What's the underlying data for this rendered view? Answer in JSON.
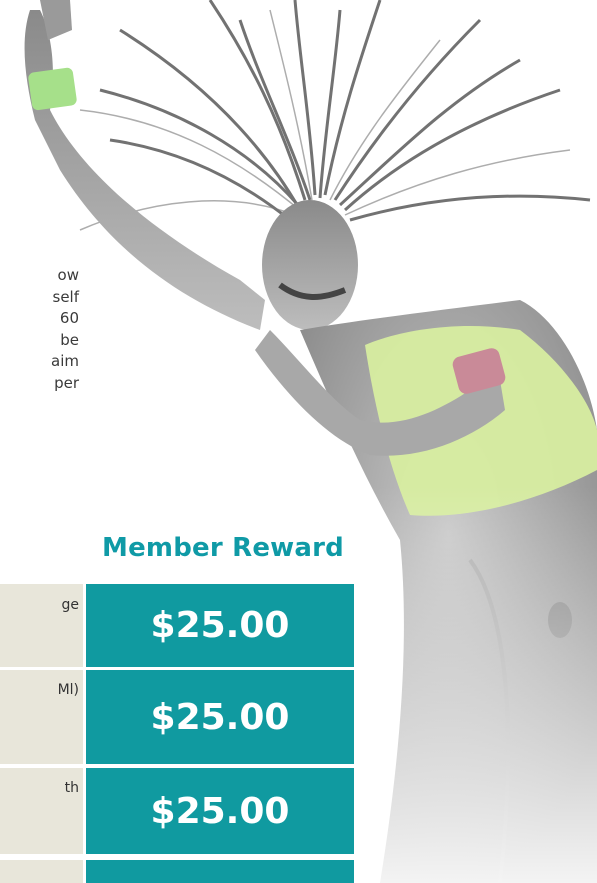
{
  "paragraph_lines": [
    "ow",
    "self",
    "60",
    "be",
    "aim",
    "per"
  ],
  "member_reward": {
    "heading": "Member Reward",
    "rows": [
      {
        "label_fragment": "ge",
        "amount": "$25.00"
      },
      {
        "label_fragment": "Ml)",
        "amount": "$25.00"
      },
      {
        "label_fragment": "th",
        "amount": "$25.00"
      },
      {
        "label_fragment": "",
        "amount": ""
      }
    ]
  },
  "colors": {
    "accent": "#109aa0",
    "row_bg": "#e8e6da",
    "wristband": "#a6e08a"
  }
}
